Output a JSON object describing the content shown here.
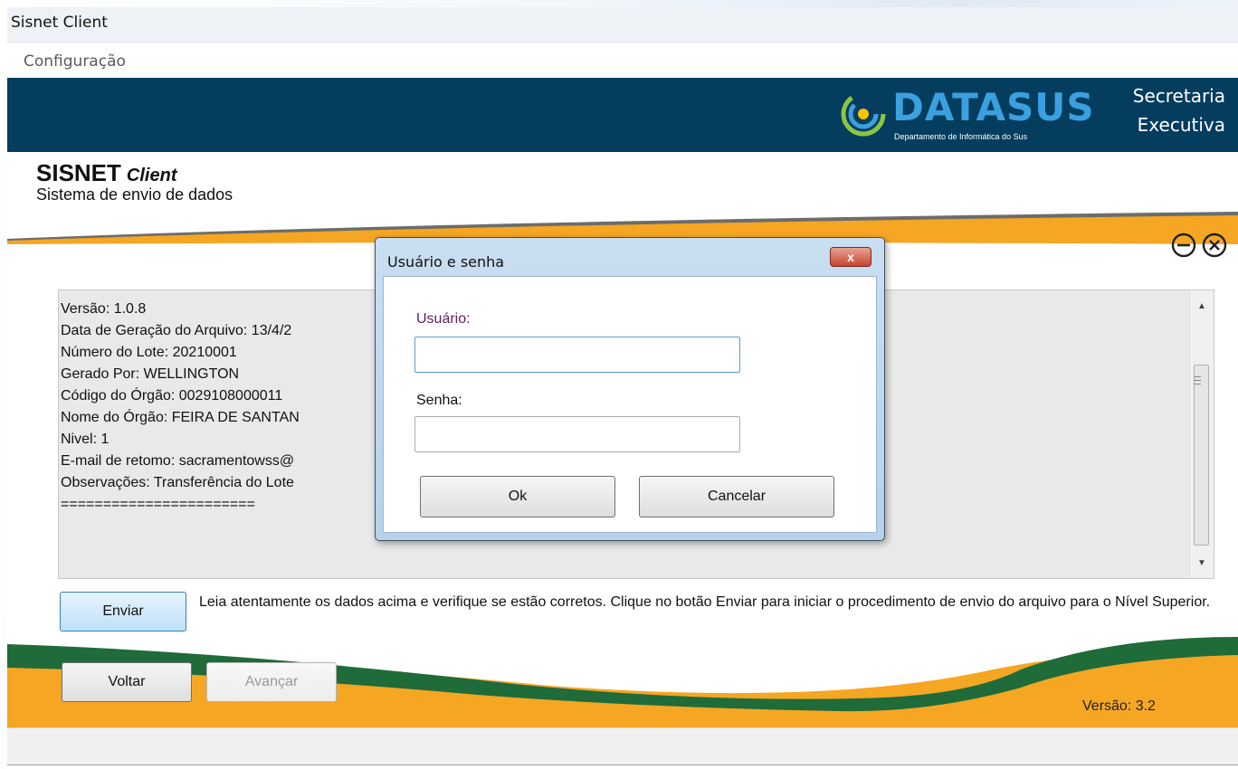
{
  "window": {
    "title": "Sisnet Client"
  },
  "menu": {
    "items": [
      "Configuração"
    ]
  },
  "banner": {
    "logo_text": "DATASUS",
    "logo_subtitle": "Departamento de Informática do Sus",
    "secretaria_line1": "Secretaria",
    "secretaria_line2": "Executiva",
    "background_color": "#043d5e"
  },
  "product": {
    "name": "SISNET",
    "name_suffix": "Client",
    "subtitle": "Sistema de envio de dados"
  },
  "details": {
    "lines": [
      "Versão: 1.0.8",
      "Data de Geração do Arquivo: 13/4/2",
      "Número do Lote: 20210001",
      "Gerado Por: WELLINGTON",
      "Código do Órgão: 0029108000011",
      "Nome do Órgão: FEIRA DE SANTAN",
      "Nivel: 1",
      "E-mail de retomo:  sacramentowss@",
      "Observações: Transferência do Lote",
      "======================="
    ]
  },
  "actions": {
    "enviar_label": "Enviar",
    "info_text": "Leia atentamente os dados acima e verifique se estão corretos. Clique no botão Enviar para iniciar o procedimento de envio do arquivo para o Nível Superior.",
    "voltar_label": "Voltar",
    "avancar_label": "Avançar",
    "version_text": "Versão: 3.2"
  },
  "dialog": {
    "title": "Usuário e senha",
    "close_symbol": "x",
    "user_label": "Usuário:",
    "user_value": "",
    "password_label": "Senha:",
    "password_value": "",
    "ok_label": "Ok",
    "cancel_label": "Cancelar"
  },
  "icons": {
    "minimize": "minus-circle-icon",
    "close": "x-circle-icon",
    "scroll_up": "chevron-up-icon",
    "scroll_down": "chevron-down-icon"
  },
  "colors": {
    "accent_orange": "#f5a623",
    "accent_green": "#1f6b3a",
    "dialog_frame": "#b7d1eb"
  }
}
